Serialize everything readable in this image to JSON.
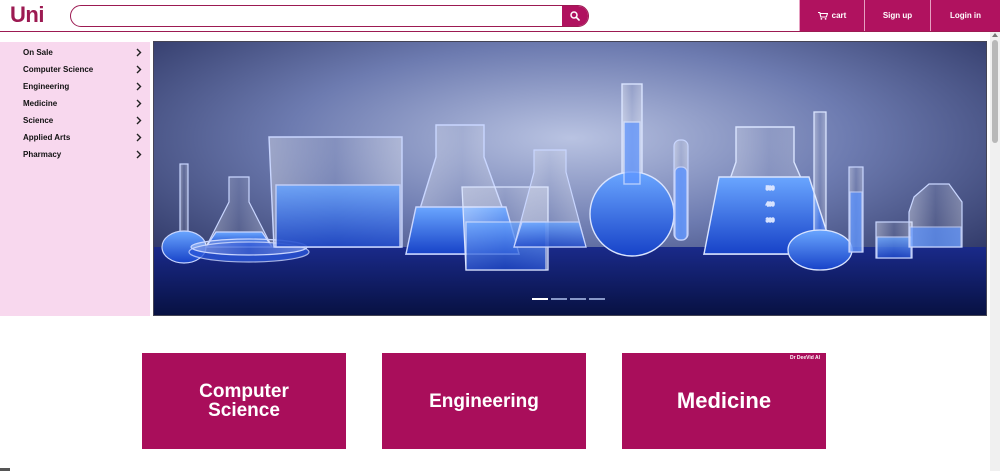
{
  "header": {
    "logo": "Uni",
    "search": {
      "placeholder": "",
      "value": ""
    },
    "nav": {
      "cart": "cart",
      "signup": "Sign up",
      "login": "Login in"
    }
  },
  "sidebar": {
    "items": [
      {
        "label": "On Sale"
      },
      {
        "label": "Computer Science"
      },
      {
        "label": "Engineering"
      },
      {
        "label": "Medicine"
      },
      {
        "label": "Science"
      },
      {
        "label": "Applied Arts"
      },
      {
        "label": "Pharmacy"
      }
    ]
  },
  "hero": {
    "slide_count": 4,
    "active_slide": 1
  },
  "tiles": {
    "computer_science": "Computer Science",
    "engineering": "Engineering",
    "medicine": "Medicine",
    "medicine_watermark": "Dr DeeVid AI"
  },
  "colors": {
    "brand": "#b0125f",
    "tile": "#a90e5b",
    "sidebar_bg": "#f8d8ee"
  },
  "icons": {
    "search": "search-icon",
    "cart": "cart-icon",
    "chevron": "chevron-right-icon"
  }
}
